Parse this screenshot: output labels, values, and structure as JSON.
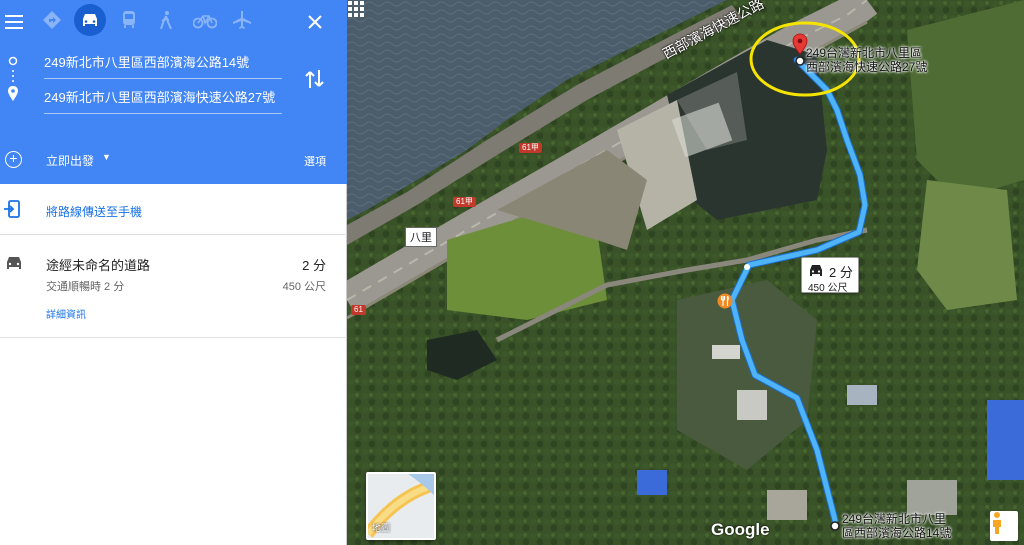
{
  "panel": {
    "modes": [
      {
        "name": "menu-icon"
      },
      {
        "name": "best-route-icon"
      },
      {
        "name": "car-icon"
      },
      {
        "name": "transit-icon"
      },
      {
        "name": "walk-icon"
      },
      {
        "name": "bicycle-icon"
      },
      {
        "name": "flight-icon"
      }
    ],
    "active_mode": "car-icon",
    "origin": "249新北市八里區西部濱海公路14號",
    "destination": "249新北市八里區西部濱海快速公路27號",
    "depart_label": "立即出發",
    "options_label": "選項",
    "send_label": "將路線傳送至手機",
    "route": {
      "name": "途經未命名的道路",
      "time": "2 分",
      "traffic": "交通順暢時 2 分",
      "distance": "450 公尺",
      "details": "詳細資訊"
    }
  },
  "map": {
    "highway_label": "西部濱海快速公路",
    "shield_labels": [
      "61甲",
      "61甲",
      "61"
    ],
    "place_label": "八里",
    "dest_label_line1": "249台灣新北市八里區",
    "dest_label_line2": "西部濱海快速公路27號",
    "origin_label_line1": "249台灣新北市八里",
    "origin_label_line2": "區西部濱海公路14號",
    "badge_time": "2 分",
    "badge_distance": "450 公尺",
    "layer_label": "地圖",
    "logo": "Google"
  },
  "colors": {
    "header": "#4285f4",
    "route": "#4fb3f7",
    "link": "#1a73e8",
    "pin": "#e53935",
    "highlight": "#f5e400"
  }
}
